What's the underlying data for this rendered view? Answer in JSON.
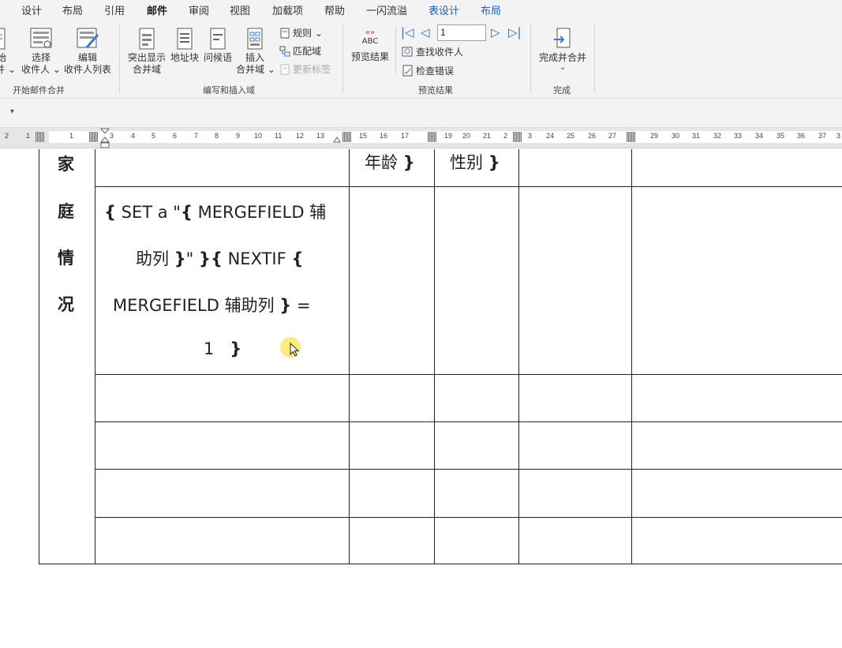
{
  "tabs": [
    {
      "label": "设计",
      "kind": "normal"
    },
    {
      "label": "布局",
      "kind": "normal"
    },
    {
      "label": "引用",
      "kind": "normal"
    },
    {
      "label": "邮件",
      "kind": "active"
    },
    {
      "label": "审阅",
      "kind": "normal"
    },
    {
      "label": "视图",
      "kind": "normal"
    },
    {
      "label": "加载项",
      "kind": "normal"
    },
    {
      "label": "帮助",
      "kind": "normal"
    },
    {
      "label": "一闪流溢",
      "kind": "normal"
    },
    {
      "label": "表设计",
      "kind": "contextual"
    },
    {
      "label": "布局",
      "kind": "contextual"
    }
  ],
  "ribbon": {
    "start": {
      "group_label": "开始邮件合并",
      "cut_button": {
        "line1": "始",
        "line2": "并 ⌄"
      },
      "select_recipients": {
        "line1": "选择",
        "line2": "收件人 ⌄"
      },
      "edit_recipients": {
        "line1": "编辑",
        "line2": "收件人列表"
      }
    },
    "write": {
      "group_label": "编写和插入域",
      "highlight": {
        "line1": "突出显示",
        "line2": "合并域"
      },
      "address": {
        "line1": "地址块"
      },
      "greeting": {
        "line1": "问候语"
      },
      "insert_field": {
        "line1": "插入",
        "line2": "合并域 ⌄"
      },
      "rules": "规则 ⌄",
      "match_fields": "匹配域",
      "update_labels": "更新标签"
    },
    "preview": {
      "group_label": "预览结果",
      "preview_results": "预览结果",
      "abc_text": "ABC",
      "record_value": "1",
      "find_recipient": "查找收件人",
      "check_errors": "检查错误"
    },
    "finish": {
      "group_label": "完成",
      "finish_merge": {
        "line1": "完成并合并",
        "line2": "⌄"
      }
    }
  },
  "ruler": {
    "numbers": [
      "2",
      "1",
      "1",
      "3",
      "4",
      "5",
      "6",
      "7",
      "8",
      "9",
      "10",
      "11",
      "12",
      "13",
      "15",
      "16",
      "17",
      "19",
      "20",
      "21",
      "2",
      "3",
      "24",
      "25",
      "26",
      "27",
      "29",
      "30",
      "31",
      "32",
      "33",
      "34",
      "35",
      "36",
      "37",
      "3"
    ]
  },
  "document": {
    "side_chars": [
      "家",
      "庭",
      "情",
      "况"
    ],
    "header_age": "年龄",
    "header_gender": "性别",
    "brace_close": "}",
    "brace_open": "{",
    "code": {
      "l1_a": "SET a \"",
      "l1_b": "MERGEFIELD  辅",
      "l2_a": "助列",
      "l2_b": "\"",
      "l2_c": "NEXTIF",
      "l3_a": "MERGEFIELD  辅助列",
      "l3_b": "=",
      "l4_a": "1"
    }
  },
  "colors": {
    "accent": "#185abd",
    "contextual_tab": "#1f5fbf",
    "cursor_highlight": "#fae650"
  }
}
